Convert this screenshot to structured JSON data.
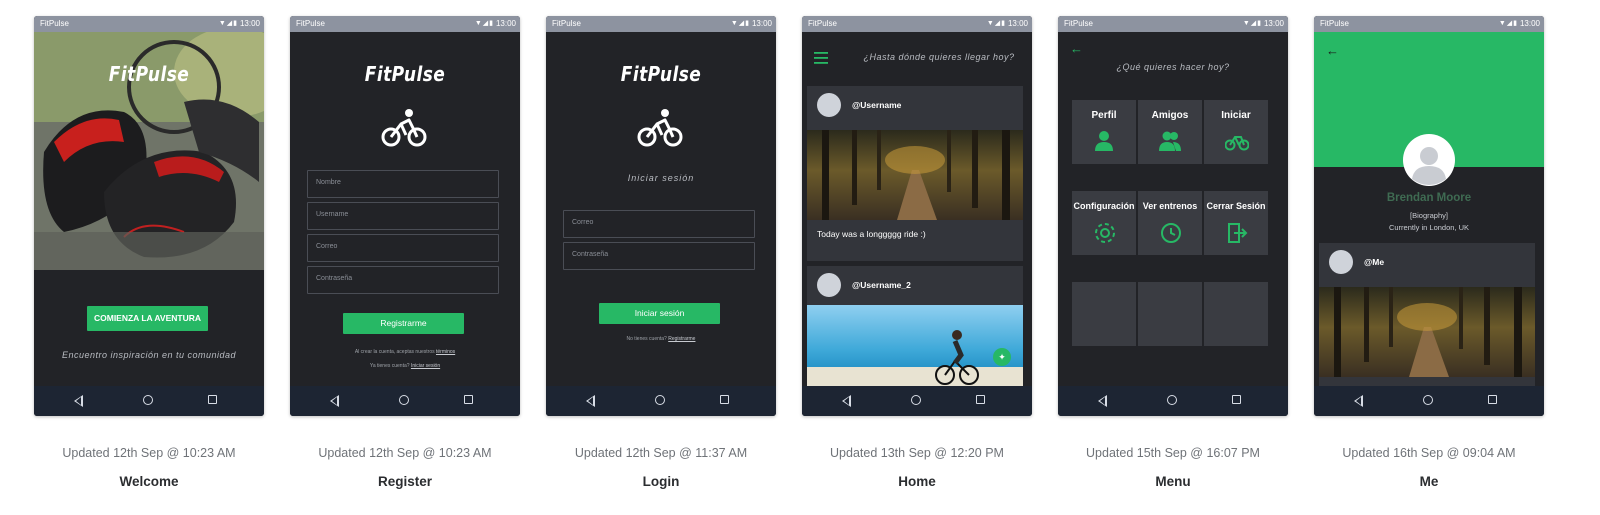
{
  "status": {
    "app": "FitPulse",
    "time": "13:00",
    "icons": "▼◢▮"
  },
  "accent": "#27b865",
  "screens": [
    {
      "date": "Updated 12th Sep @ 10:23 AM",
      "title": "Welcome"
    },
    {
      "date": "Updated 12th Sep @ 10:23 AM",
      "title": "Register"
    },
    {
      "date": "Updated 12th Sep @ 11:37 AM",
      "title": "Login"
    },
    {
      "date": "Updated 13th Sep @ 12:20 PM",
      "title": "Home"
    },
    {
      "date": "Updated 15th Sep @ 16:07 PM",
      "title": "Menu"
    },
    {
      "date": "Updated 16th Sep @ 09:04 AM",
      "title": "Me"
    }
  ],
  "welcome": {
    "logo": "FitPulse",
    "cta": "COMIENZA LA AVENTURA",
    "tagline": "Encuentro inspiración en tu comunidad"
  },
  "register": {
    "logo": "FitPulse",
    "fields": [
      "Nombre",
      "Username",
      "Correo",
      "Contraseña"
    ],
    "button": "Registrarme",
    "terms": "Al crear la cuenta, aceptas nuestros",
    "terms_link": "términos",
    "have_account": "Ya tienes cuenta?",
    "login_link": "Iniciar sesión"
  },
  "login": {
    "logo": "FitPulse",
    "subtitle": "Iniciar sesión",
    "fields": [
      "Correo",
      "Contraseña"
    ],
    "button": "Iniciar sesión",
    "no_account": "No tienes cuenta?",
    "register_link": "Registrarme"
  },
  "home": {
    "header": "¿Hasta dónde quieres llegar hoy?",
    "posts": [
      {
        "user": "@Username",
        "caption": "Today was a longgggg ride :)"
      },
      {
        "user": "@Username_2"
      }
    ]
  },
  "menu": {
    "header": "¿Qué quieres hacer hoy?",
    "tiles": [
      "Perfil",
      "Amigos",
      "Iniciar",
      "Configuración",
      "Ver entrenos",
      "Cerrar Sesión"
    ]
  },
  "me": {
    "name": "Brendan Moore",
    "bio": "[Biography]",
    "location": "Currently in London, UK",
    "post_user": "@Me"
  }
}
